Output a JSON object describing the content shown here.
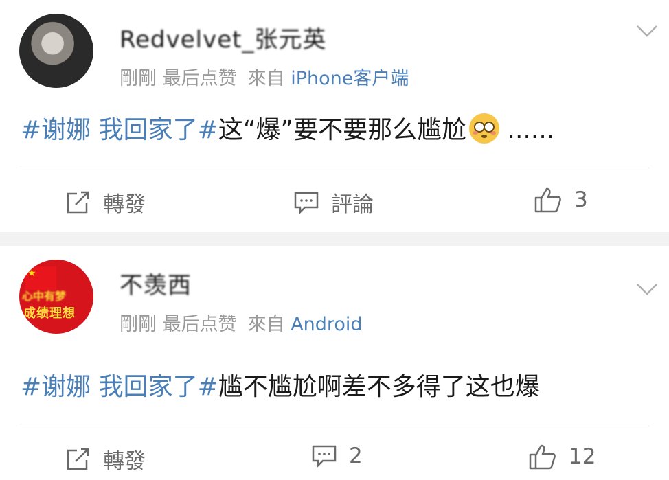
{
  "posts": [
    {
      "username": "Redvelvet_张元英",
      "time": "剛剛",
      "liked_note": "最后点赞",
      "from_label": "來自",
      "client": "iPhone客户端",
      "tag": "#谢娜 我回家了#",
      "text": "这“爆”要不要那么尴尬",
      "emoji": "flushed-face-emoji",
      "ellipsis": "......",
      "actions": {
        "repost": "轉發",
        "comment": "評論",
        "like": "3"
      }
    },
    {
      "username": "不羡西",
      "time": "剛剛",
      "liked_note": "最后点赞",
      "from_label": "來自",
      "client": "Android",
      "avatar_text_top": "心中有梦",
      "avatar_text_bottom": "成绩理想",
      "tag": "#谢娜 我回家了#",
      "text": "尴不尴尬啊差不多得了这也爆",
      "actions": {
        "repost": "轉發",
        "comment": "2",
        "like": "12"
      }
    }
  ],
  "colors": {
    "link": "#4a7fb8",
    "meta": "#9a9a9a",
    "separator_band": "#f2f2f2"
  }
}
